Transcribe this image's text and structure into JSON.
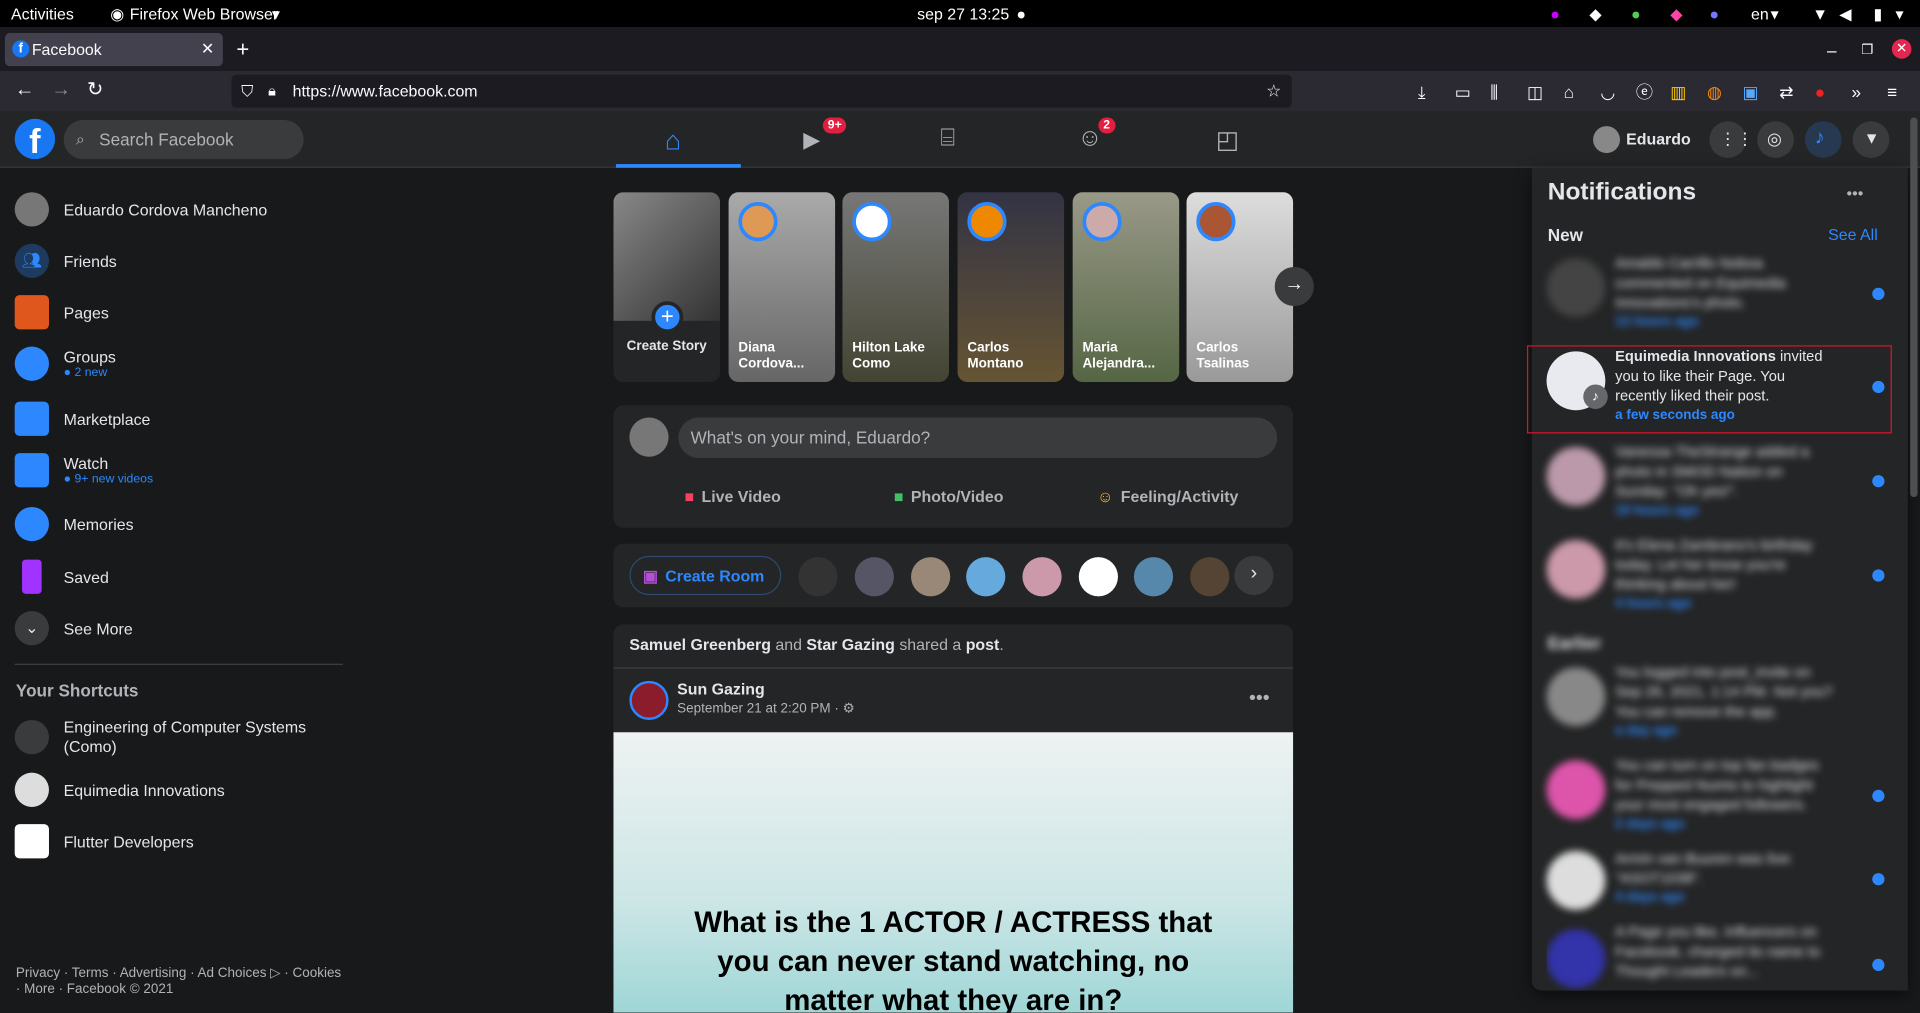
{
  "gnome": {
    "activities": "Activities",
    "app": "Firefox Web Browser",
    "datetime": "sep 27  13:25",
    "lang": "en"
  },
  "browser": {
    "tab_title": "Facebook",
    "url": "https://www.facebook.com"
  },
  "header": {
    "search_placeholder": "Search Facebook",
    "user_name": "Eduardo",
    "watch_badge": "9+",
    "groups_badge": "2"
  },
  "sidebar": {
    "profile": "Eduardo Cordova Mancheno",
    "items": [
      {
        "label": "Friends"
      },
      {
        "label": "Pages"
      },
      {
        "label": "Groups",
        "sub": "2 new"
      },
      {
        "label": "Marketplace"
      },
      {
        "label": "Watch",
        "sub": "9+ new videos"
      },
      {
        "label": "Memories"
      },
      {
        "label": "Saved"
      },
      {
        "label": "See More"
      }
    ],
    "shortcuts_title": "Your Shortcuts",
    "shortcuts": [
      {
        "label": "Engineering of Computer Systems (Como)"
      },
      {
        "label": "Equimedia Innovations"
      },
      {
        "label": "Flutter Developers"
      }
    ],
    "footer": "Privacy · Terms · Advertising · Ad Choices ▷ · Cookies · More · Facebook © 2021"
  },
  "stories": [
    {
      "name": "Create Story"
    },
    {
      "name": "Diana Cordova..."
    },
    {
      "name": "Hilton Lake Como"
    },
    {
      "name": "Carlos Montano"
    },
    {
      "name": "Maria Alejandra..."
    },
    {
      "name": "Carlos Tsalinas"
    }
  ],
  "composer": {
    "placeholder": "What's on your mind, Eduardo?",
    "live": "Live Video",
    "photo": "Photo/Video",
    "feeling": "Feeling/Activity"
  },
  "rooms": {
    "create": "Create Room"
  },
  "post": {
    "shared_a": "Samuel Greenberg",
    "and": "and",
    "shared_b": "Star Gazing",
    "shared_txt": "shared a",
    "shared_obj": "post",
    "period": ".",
    "page": "Sun Gazing",
    "date": "September 21 at 2:20 PM · ⚙",
    "text": "What is the 1 ACTOR / ACTRESS that you can never stand watching, no matter what they are in?"
  },
  "notifications": {
    "title": "Notifications",
    "new": "New",
    "see_all": "See All",
    "earlier": "Earlier",
    "highlight": {
      "name": "Equimedia Innovations",
      "text": " invited you to like their Page. You recently liked their post.",
      "time": "a few seconds ago"
    },
    "blurred": [
      {
        "text": "Amaldo Carrillo Noboa commented on Equimedia Innovations's photo.",
        "time": "13 hours ago"
      },
      {
        "text": "Vanessa TheStrange added a photo in SMOD Nation on Sunday: \"Oh yes!\".",
        "time": "19 hours ago"
      },
      {
        "text": "It's Elena Zambrano's birthday today. Let her know you're thinking about her!",
        "time": "4 hours ago"
      },
      {
        "text": "You logged into post_invite on Sep 26, 2021, 1:14 PM. Not you? You can remove the app.",
        "time": "a day ago"
      },
      {
        "text": "You can turn on top fan badges for Prepped Numis to highlight your most engaged followers.",
        "time": "2 days ago"
      },
      {
        "text": "Armin van Buuren was live: \"ASOT1038\".",
        "time": "4 days ago"
      },
      {
        "text": "A Page you like, Influencers on Facebook, changed its name to Thought Leaders on...",
        "time": ""
      }
    ]
  }
}
